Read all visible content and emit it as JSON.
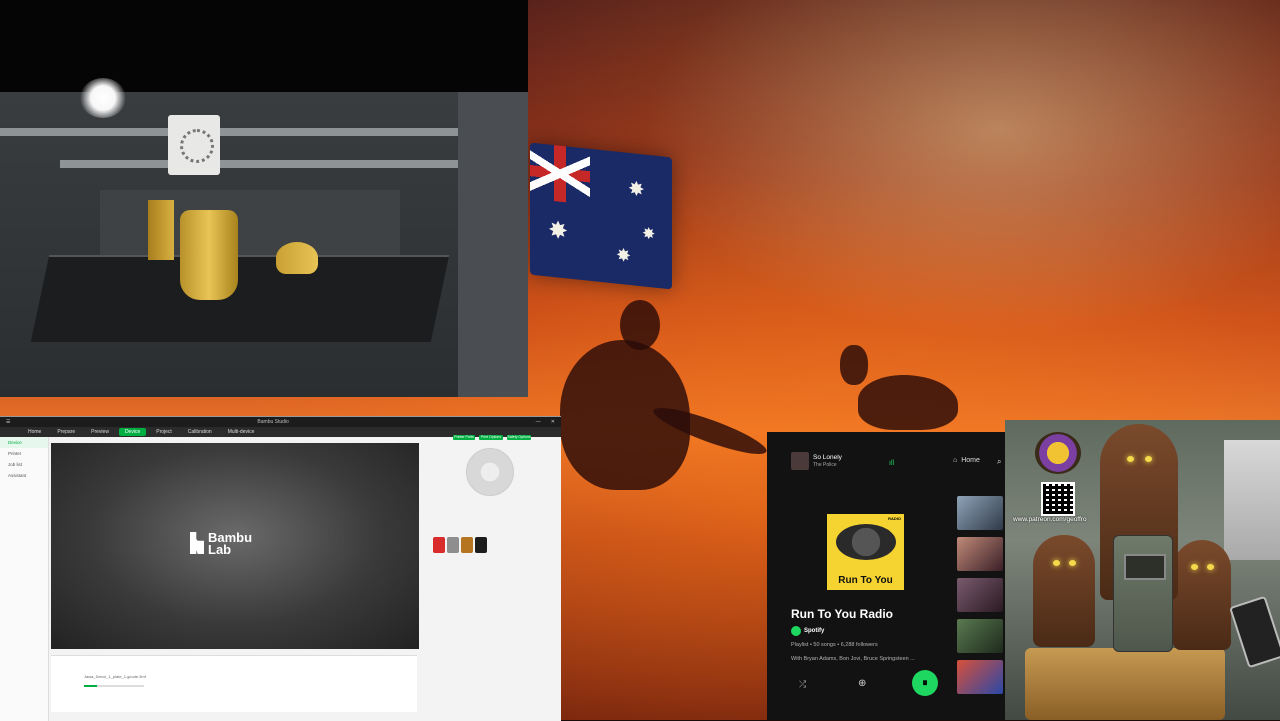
{
  "studio": {
    "title": "Bambu Studio",
    "tabs": [
      "Home",
      "Prepare",
      "Preview",
      "Device",
      "Project",
      "Calibration",
      "Multi-device"
    ],
    "active_tab": "Device",
    "sidebar": [
      "Device",
      "Printer",
      "Job list",
      "Assistant"
    ],
    "logo": "Bambu Lab",
    "controls": {
      "buttons": [
        "Printer Parts",
        "Print Options",
        "Safety Options"
      ]
    },
    "job": {
      "file": "Jawa_Decor_1_plate_1.gcode.3mf",
      "progress": 0.22
    }
  },
  "spotify": {
    "now_playing": {
      "song": "So Lonely",
      "artist": "The Police"
    },
    "nav": {
      "home": "Home"
    },
    "cover": {
      "badge": "RADIO",
      "title": "Run To You"
    },
    "playlist_title": "Run To You Radio",
    "owner": "Spotify",
    "meta": "Playlist • 50 songs • 6,288 followers",
    "with_artists": "With Bryan Adams, Bon Jovi, Bruce Springsteen ...",
    "icons": {
      "shuffle": "⤮",
      "add": "⊕",
      "pause": "⏸",
      "home": "⌂",
      "search": "⌕",
      "bars": "ıll"
    }
  },
  "overlay": {
    "patreon_url": "www.patreon.com/geoffro"
  },
  "colors": {
    "bambu_green": "#00ae42",
    "spotify_green": "#1ed760",
    "spotify_bg": "#121212",
    "cover_yellow": "#f5d330"
  }
}
